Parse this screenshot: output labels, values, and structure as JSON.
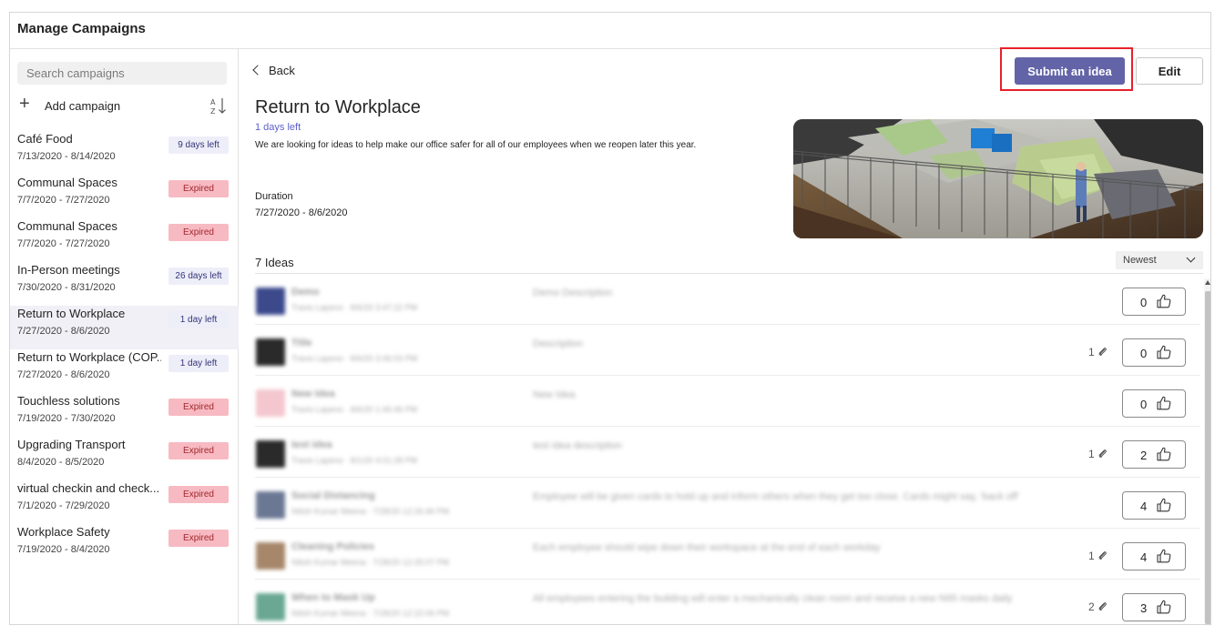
{
  "window": {
    "title": "Manage Campaigns"
  },
  "sidebar": {
    "search_placeholder": "Search campaigns",
    "add_campaign_label": "Add campaign",
    "campaigns": [
      {
        "name": "Café Food",
        "dates": "7/13/2020 - 8/14/2020",
        "status": "9 days left",
        "status_type": "active",
        "selected": false
      },
      {
        "name": "Communal Spaces",
        "dates": "7/7/2020 - 7/27/2020",
        "status": "Expired",
        "status_type": "expired",
        "selected": false
      },
      {
        "name": "Communal Spaces",
        "dates": "7/7/2020 - 7/27/2020",
        "status": "Expired",
        "status_type": "expired",
        "selected": false
      },
      {
        "name": "In-Person meetings",
        "dates": "7/30/2020 - 8/31/2020",
        "status": "26 days left",
        "status_type": "active",
        "selected": false
      },
      {
        "name": "Return to Workplace",
        "dates": "7/27/2020 - 8/6/2020",
        "status": "1 day left",
        "status_type": "active",
        "selected": true
      },
      {
        "name": "Return to Workplace (COP...",
        "dates": "7/27/2020 - 8/6/2020",
        "status": "1 day left",
        "status_type": "active",
        "selected": false
      },
      {
        "name": "Touchless solutions",
        "dates": "7/19/2020 - 7/30/2020",
        "status": "Expired",
        "status_type": "expired",
        "selected": false
      },
      {
        "name": "Upgrading Transport",
        "dates": "8/4/2020 - 8/5/2020",
        "status": "Expired",
        "status_type": "expired",
        "selected": false
      },
      {
        "name": "virtual checkin and check...",
        "dates": "7/1/2020 - 7/29/2020",
        "status": "Expired",
        "status_type": "expired",
        "selected": false
      },
      {
        "name": "Workplace Safety",
        "dates": "7/19/2020 - 8/4/2020",
        "status": "Expired",
        "status_type": "expired",
        "selected": false
      }
    ]
  },
  "detail": {
    "back_label": "Back",
    "submit_label": "Submit an idea",
    "edit_label": "Edit",
    "title": "Return to Workplace",
    "days_left": "1 days left",
    "description": "We are looking for ideas to help make our office safer for all of our employees when we reopen later this year.",
    "duration_label": "Duration",
    "duration_value": "7/27/2020 - 8/6/2020",
    "ideas_count": "7 Ideas",
    "sort_value": "Newest"
  },
  "ideas": [
    {
      "title": "Demo",
      "sub": "Travis Lapeno · 8/6/20 3:47:22 PM",
      "desc": "Demo Description",
      "attachments": "",
      "likes": "0",
      "thumb_color": "#3c4a8c"
    },
    {
      "title": "Title",
      "sub": "Travis Lapeno · 8/6/20 3:46:03 PM",
      "desc": "Description",
      "attachments": "1",
      "likes": "0",
      "thumb_color": "#2a2a2a"
    },
    {
      "title": "New Idea",
      "sub": "Travis Lapeno · 8/6/20 1:46:46 PM",
      "desc": "New Idea",
      "attachments": "",
      "likes": "0",
      "thumb_color": "#f4c7cf"
    },
    {
      "title": "test idea",
      "sub": "Travis Lapeno · 8/1/20 4:01:28 PM",
      "desc": "test idea description",
      "attachments": "1",
      "likes": "2",
      "thumb_color": "#2a2a2a"
    },
    {
      "title": "Social Distancing",
      "sub": "Nitish Kumar Meena · 7/28/20 12:26:46 PM",
      "desc": "Employee will be given cards to hold up and inform others when they get too close. Cards might say, 'back off'",
      "attachments": "",
      "likes": "4",
      "thumb_color": "#6b7894"
    },
    {
      "title": "Cleaning Policies",
      "sub": "Nitish Kumar Meena · 7/28/20 12:25:07 PM",
      "desc": "Each employee should wipe down their workspace at the end of each workday",
      "attachments": "1",
      "likes": "4",
      "thumb_color": "#a6876a"
    },
    {
      "title": "When to Mask Up",
      "sub": "Nitish Kumar Meena · 7/28/20 12:22:06 PM",
      "desc": "All employees entering the building will enter a mechanically clean room and receive a new N95 masks daily",
      "attachments": "2",
      "likes": "3",
      "thumb_color": "#6aa893"
    }
  ]
}
